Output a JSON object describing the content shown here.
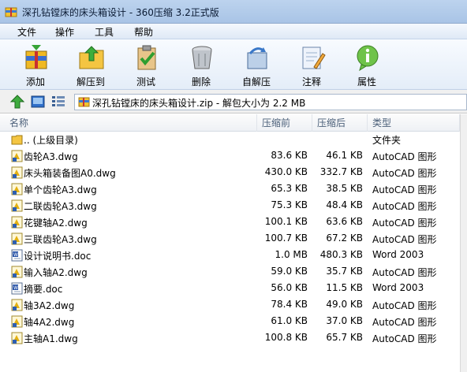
{
  "window": {
    "title": "深孔钻镗床的床头箱设计 - 360压缩 3.2正式版"
  },
  "menu": [
    "文件",
    "操作",
    "工具",
    "帮助"
  ],
  "toolbar": [
    {
      "label": "添加",
      "icon": "add-archive-icon"
    },
    {
      "label": "解压到",
      "icon": "extract-folder-icon"
    },
    {
      "label": "测试",
      "icon": "test-clipboard-icon"
    },
    {
      "label": "删除",
      "icon": "trash-can-icon"
    },
    {
      "label": "自解压",
      "icon": "self-extract-icon"
    },
    {
      "label": "注释",
      "icon": "comment-pencil-icon"
    },
    {
      "label": "属性",
      "icon": "info-icon"
    }
  ],
  "address": {
    "text": "深孔钻镗床的床头箱设计.zip - 解包大小为 2.2 MB"
  },
  "columns": {
    "name": "名称",
    "compressed": "压缩前",
    "size": "压缩后",
    "type": "类型"
  },
  "files": [
    {
      "name": ".. (上级目录)",
      "compressed": "",
      "size": "",
      "type": "文件夹",
      "icon": "folder"
    },
    {
      "name": "齿轮A3.dwg",
      "compressed": "83.6 KB",
      "size": "46.1 KB",
      "type": "AutoCAD 图形",
      "icon": "dwg"
    },
    {
      "name": "床头箱装备图A0.dwg",
      "compressed": "430.0 KB",
      "size": "332.7 KB",
      "type": "AutoCAD 图形",
      "icon": "dwg"
    },
    {
      "name": "单个齿轮A3.dwg",
      "compressed": "65.3 KB",
      "size": "38.5 KB",
      "type": "AutoCAD 图形",
      "icon": "dwg"
    },
    {
      "name": "二联齿轮A3.dwg",
      "compressed": "75.3 KB",
      "size": "48.4 KB",
      "type": "AutoCAD 图形",
      "icon": "dwg"
    },
    {
      "name": "花键轴A2.dwg",
      "compressed": "100.1 KB",
      "size": "63.6 KB",
      "type": "AutoCAD 图形",
      "icon": "dwg"
    },
    {
      "name": "三联齿轮A3.dwg",
      "compressed": "100.7 KB",
      "size": "67.2 KB",
      "type": "AutoCAD 图形",
      "icon": "dwg"
    },
    {
      "name": "设计说明书.doc",
      "compressed": "1.0 MB",
      "size": "480.3 KB",
      "type": "Word 2003",
      "icon": "doc"
    },
    {
      "name": "输入轴A2.dwg",
      "compressed": "59.0 KB",
      "size": "35.7 KB",
      "type": "AutoCAD 图形",
      "icon": "dwg"
    },
    {
      "name": "摘要.doc",
      "compressed": "56.0 KB",
      "size": "11.5 KB",
      "type": "Word 2003",
      "icon": "doc"
    },
    {
      "name": "轴3A2.dwg",
      "compressed": "78.4 KB",
      "size": "49.0 KB",
      "type": "AutoCAD 图形",
      "icon": "dwg"
    },
    {
      "name": "轴4A2.dwg",
      "compressed": "61.0 KB",
      "size": "37.0 KB",
      "type": "AutoCAD 图形",
      "icon": "dwg"
    },
    {
      "name": "主轴A1.dwg",
      "compressed": "100.8 KB",
      "size": "65.7 KB",
      "type": "AutoCAD 图形",
      "icon": "dwg"
    }
  ]
}
